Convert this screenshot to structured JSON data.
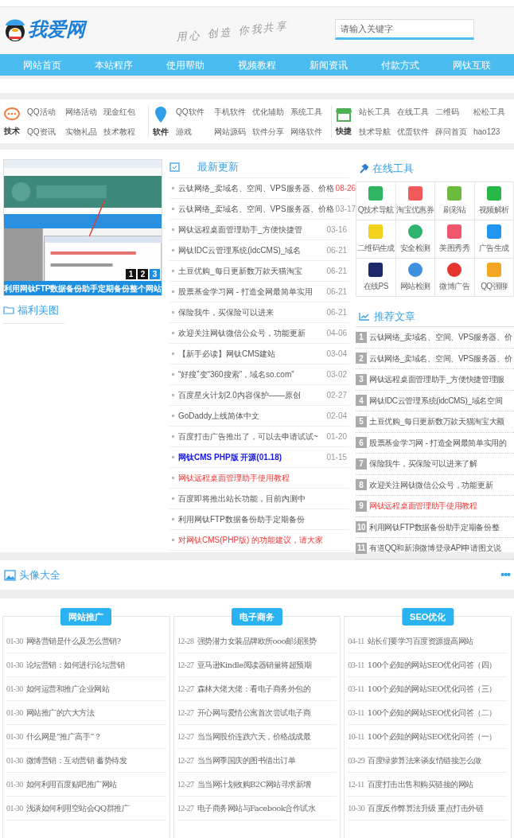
{
  "header": {
    "logo": "我爱网",
    "slogan": "用心 创造 你我共享",
    "search": {
      "placeholder": "请输入关键字"
    }
  },
  "nav": [
    {
      "label": "网站首页",
      "selected": false
    },
    {
      "label": "本站程序",
      "selected": false
    },
    {
      "label": "使用帮助",
      "selected": false
    },
    {
      "label": "视频教程",
      "selected": false
    },
    {
      "label": "新闻资讯",
      "selected": false
    },
    {
      "label": "付款方式",
      "selected": false
    },
    {
      "label": "网钛互联",
      "selected": false
    }
  ],
  "categories": [
    {
      "kind": "chat",
      "label": "技术",
      "links": [
        "QQ活动",
        "网络活动",
        "现金红包",
        "QQ资讯",
        "实物礼品",
        "技术教程"
      ]
    },
    {
      "kind": "pin",
      "label": "软件",
      "links": [
        "QQ软件",
        "手机软件",
        "优化辅助",
        "系统工具",
        "游戏",
        "网站源码",
        "软件分享",
        "网络软件"
      ]
    },
    {
      "kind": "shop",
      "label": "快捷",
      "links": [
        "站长工具",
        "在线工具",
        "二维码",
        "松松工具",
        "技术导航",
        "优蛋软件",
        "薛问首页",
        "hao123"
      ]
    }
  ],
  "slider": {
    "caption": "利用网钛FTP数据备份助手定期备份整个网站",
    "pages": [
      {
        "label": "1",
        "selected": false
      },
      {
        "label": "2",
        "selected": false
      },
      {
        "label": "3",
        "selected": true
      }
    ]
  },
  "gallery_title": "福利美图",
  "latest": {
    "title": "最新更新",
    "items": [
      {
        "text": "云钛网络_卖域名、空间、VPS服务器、价格",
        "date": "08-26",
        "hot": true,
        "kind": "normal"
      },
      {
        "text": "云钛网络_卖域名、空间、VPS服务器、价格",
        "date": "03-17",
        "hot": false,
        "kind": "normal"
      },
      {
        "text": "网钛远程桌面管理助手_方便快捷管",
        "date": "03-16",
        "hot": false,
        "kind": "normal"
      },
      {
        "text": "网钛IDC云管理系统(idcCMS)_域名",
        "date": "06-21",
        "hot": false,
        "kind": "normal"
      },
      {
        "text": "土豆优购_每日更新数万款天猫淘宝",
        "date": "06-21",
        "hot": false,
        "kind": "normal"
      },
      {
        "text": "股票基金学习网 - 打造全网最简单实用",
        "date": "06-21",
        "hot": false,
        "kind": "normal"
      },
      {
        "text": "保险我牛，买保险可以进来",
        "date": "06-21",
        "hot": false,
        "kind": "normal"
      },
      {
        "text": "欢迎关注网钛微信公众号，功能更新",
        "date": "04-06",
        "hot": false,
        "kind": "normal"
      },
      {
        "text": "【新手必读】网钛CMS建站",
        "date": "03-04",
        "hot": false,
        "kind": "normal"
      },
      {
        "text": "“好搜”变“360搜索”，域名so.com”",
        "date": "03-02",
        "hot": false,
        "kind": "normal"
      },
      {
        "text": "百度星火计划2.0内容保护——原创",
        "date": "02-27",
        "hot": false,
        "kind": "normal"
      },
      {
        "text": "GoDaddy上线简体中文",
        "date": "02-04",
        "hot": false,
        "kind": "normal"
      },
      {
        "text": "百度打击广告推出了，可以去申请试试~",
        "date": "01-20",
        "hot": false,
        "kind": "normal"
      },
      {
        "text": "网钛CMS PHP版 开源(01.18)",
        "date": "01-15",
        "hot": false,
        "kind": "blue"
      },
      {
        "text": "网钛远程桌面管理助手使用教程",
        "kind": "red"
      },
      {
        "text": "百度即将推出站长功能，目前内测中",
        "kind": "normal"
      },
      {
        "text": "利用网钛FTP数据备份助手定期备份",
        "kind": "normal"
      },
      {
        "text": "对网钛CMS(PHP版) 的功能建议，请大家",
        "kind": "red"
      }
    ]
  },
  "tools": {
    "title": "在线工具",
    "items": [
      {
        "label": "Q技术导航",
        "kind": "nav"
      },
      {
        "label": "淘宝优惠券",
        "kind": "coupon"
      },
      {
        "label": "刷彩钻",
        "kind": "game"
      },
      {
        "label": "视频解析",
        "kind": "video"
      },
      {
        "label": "二维码生成",
        "kind": "qr"
      },
      {
        "label": "安全检测",
        "kind": "shield"
      },
      {
        "label": "美图秀秀",
        "kind": "camera"
      },
      {
        "label": "广告生成",
        "kind": "cloud"
      },
      {
        "label": "在线PS",
        "kind": "ps"
      },
      {
        "label": "网站检测",
        "kind": "badge"
      },
      {
        "label": "微博广告",
        "kind": "weibo"
      },
      {
        "label": "QQ强聊",
        "kind": "qq"
      }
    ]
  },
  "recommended": {
    "title": "推荐文章",
    "items": [
      {
        "num": "1",
        "text": "云钛网络_卖域名、空间、VPS服务器、价",
        "kind": "normal"
      },
      {
        "num": "2",
        "text": "云钛网络_卖域名、空间、VPS服务器、价",
        "kind": "normal"
      },
      {
        "num": "3",
        "text": "网钛远程桌面管理助手_方便快捷管理服",
        "kind": "normal"
      },
      {
        "num": "4",
        "text": "网钛IDC云管理系统(idcCMS)_域名空间",
        "kind": "normal"
      },
      {
        "num": "5",
        "text": "土豆优购_每日更新数万款天猫淘宝大额",
        "kind": "normal"
      },
      {
        "num": "6",
        "text": "股票基金学习网 - 打造全网最简单实用的",
        "kind": "normal"
      },
      {
        "num": "7",
        "text": "保险我牛，买保险可以进来了解",
        "kind": "normal"
      },
      {
        "num": "8",
        "text": "欢迎关注网钛微信公众号，功能更新",
        "kind": "normal"
      },
      {
        "num": "9",
        "text": "网钛远程桌面管理助手使用教程",
        "kind": "red"
      },
      {
        "num": "10",
        "text": "利用网钛FTP数据备份助手定期备份整",
        "kind": "normal"
      },
      {
        "num": "11",
        "text": "有道QQ和新浪微博登录API申请图文说",
        "kind": "normal"
      }
    ]
  },
  "avatar_section": {
    "title": "头像大全",
    "more": "•••"
  },
  "columns": [
    {
      "tab": "网站推广",
      "items": [
        {
          "date": "01-30",
          "text": "网络营销是什么及怎么营销?"
        },
        {
          "date": "01-30",
          "text": "论坛营销：如何进行论坛营销"
        },
        {
          "date": "01-30",
          "text": "如何运营和推广企业网站"
        },
        {
          "date": "01-30",
          "text": "网站推广的六大方法"
        },
        {
          "date": "01-30",
          "text": "什么网是“推广高手”？"
        },
        {
          "date": "01-30",
          "text": "微博营销：互动营销 蓄势待发"
        },
        {
          "date": "01-30",
          "text": "如何利用百度贴吧推广网站"
        },
        {
          "date": "01-30",
          "text": "浅谈如何利用空站会QQ群推广"
        }
      ]
    },
    {
      "tab": "电子商务",
      "items": [
        {
          "date": "12-28",
          "text": "强势潜力女装品牌欧所ooo邮须强势"
        },
        {
          "date": "12-27",
          "text": "亚马逊Kindle阅读器销量将超预期"
        },
        {
          "date": "12-27",
          "text": "森林大佬大佬：看电子商务外包的"
        },
        {
          "date": "12-27",
          "text": "开心网与爱情公寓首次尝试电子商"
        },
        {
          "date": "12-27",
          "text": "当当网股价连跌六天，价格战成最"
        },
        {
          "date": "12-27",
          "text": "当当网季国庆的图书借出订单"
        },
        {
          "date": "12-27",
          "text": "当当网计划收购B2C网站寻求新增"
        },
        {
          "date": "12-27",
          "text": "电子商务网站与Facebook合作试水"
        }
      ]
    },
    {
      "tab": "SEO优化",
      "items": [
        {
          "date": "04-11",
          "text": "站长们要学习百度资源提高网站"
        },
        {
          "date": "03-11",
          "text": "100个必知的网站SEO优化问答（四）"
        },
        {
          "date": "03-11",
          "text": "100个必知的网站SEO优化问答（三）"
        },
        {
          "date": "03-11",
          "text": "100个必知的网站SEO优化问答（二）"
        },
        {
          "date": "10-11",
          "text": "100个必知的网站SEO优化问答（一）"
        },
        {
          "date": "03-29",
          "text": "百度绿萝算法来谈友情链接怎么做"
        },
        {
          "date": "12-11",
          "text": "百度打击出售和购买链接的网站"
        },
        {
          "date": "10-30",
          "text": "百度反作弊算法升级 重点打击外链"
        }
      ]
    }
  ]
}
